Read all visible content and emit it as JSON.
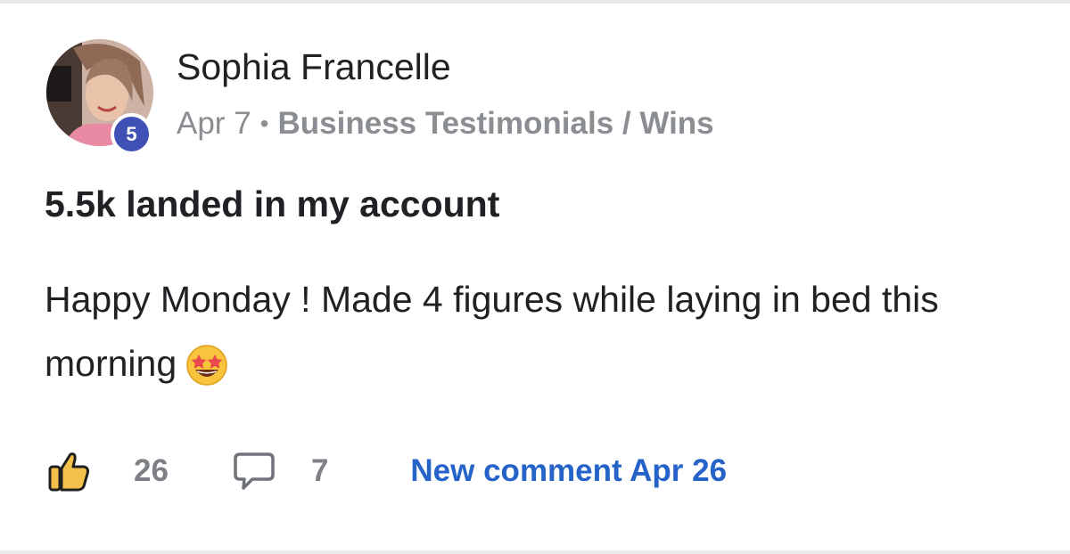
{
  "post": {
    "author": {
      "name": "Sophia Francelle",
      "level": "5"
    },
    "date": "Apr 7",
    "separator": "•",
    "category": "Business Testimonials / Wins",
    "title": "5.5k landed in my account",
    "body": "Happy Monday ! Made 4 figures while laying in bed this morning",
    "emoji": "star-struck-emoji"
  },
  "actions": {
    "like_icon": "thumbs-up-icon",
    "likes": "26",
    "comment_icon": "comment-bubble-icon",
    "comments": "7",
    "new_comment_label": "New comment Apr 26"
  },
  "colors": {
    "link": "#2563c9",
    "badge": "#3f51b5",
    "like_fill": "#f5c04a",
    "muted_text": "#8a8d91"
  }
}
